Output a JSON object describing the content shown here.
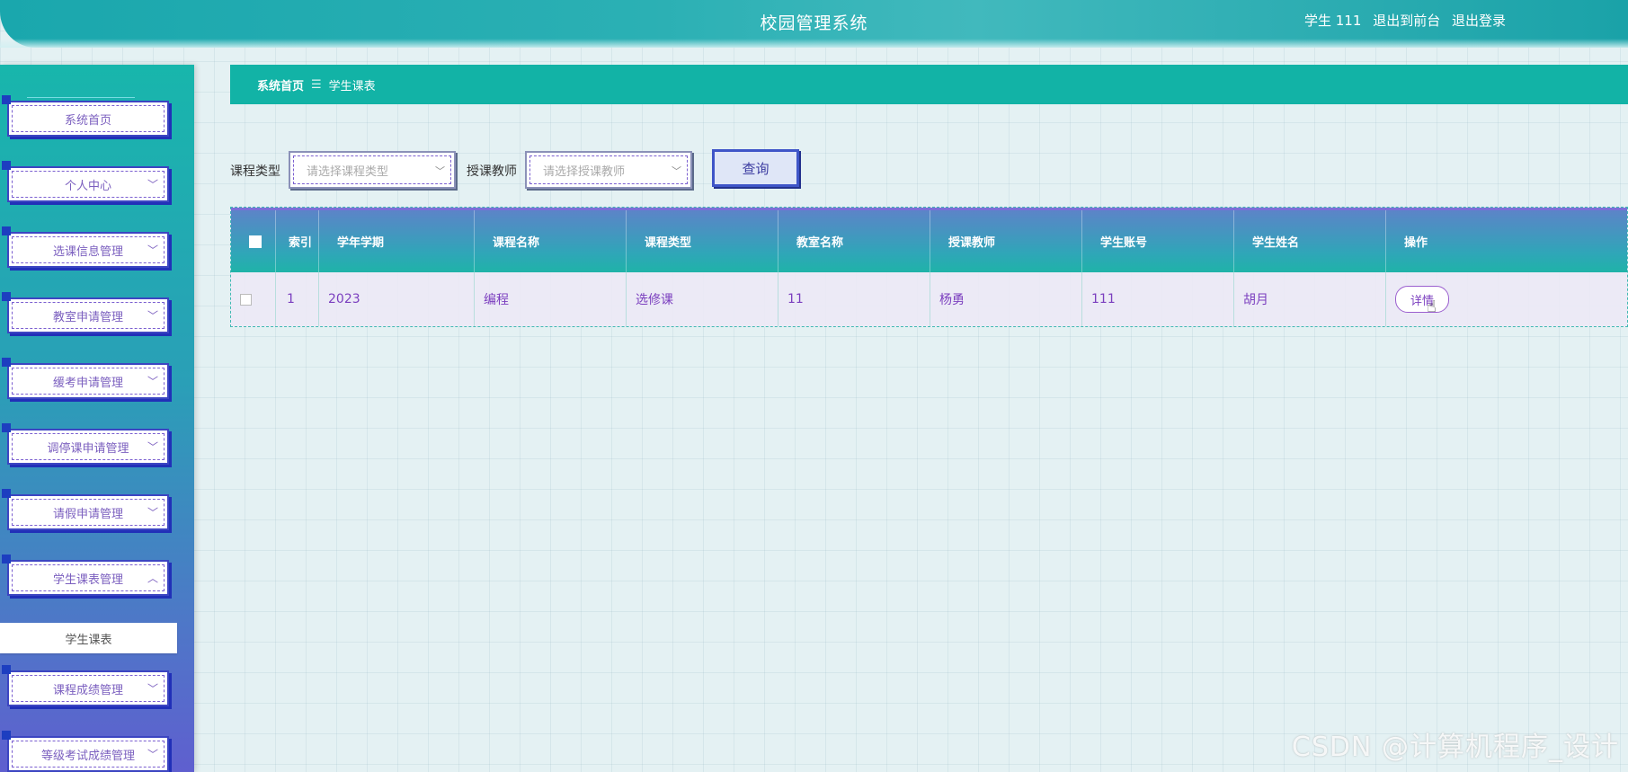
{
  "header": {
    "title": "校园管理系统",
    "user": "学生 111",
    "front_link": "退出到前台",
    "logout_link": "退出登录"
  },
  "sidebar": {
    "items": [
      {
        "label": "系统首页",
        "has_chevron": false
      },
      {
        "label": "个人中心",
        "has_chevron": true
      },
      {
        "label": "选课信息管理",
        "has_chevron": true
      },
      {
        "label": "教室申请管理",
        "has_chevron": true
      },
      {
        "label": "缓考申请管理",
        "has_chevron": true
      },
      {
        "label": "调停课申请管理",
        "has_chevron": true
      },
      {
        "label": "请假申请管理",
        "has_chevron": true
      },
      {
        "label": "学生课表管理",
        "has_chevron": true,
        "expanded": true
      },
      {
        "label": "课程成绩管理",
        "has_chevron": true
      },
      {
        "label": "等级考试成绩管理",
        "has_chevron": true
      }
    ],
    "sub_item": "学生课表",
    "chevron_down": "﹀",
    "chevron_up": "︿"
  },
  "breadcrumb": {
    "home": "系统首页",
    "separator": "☰",
    "current": "学生课表"
  },
  "filters": {
    "course_type_label": "课程类型",
    "course_type_placeholder": "请选择课程类型",
    "teacher_label": "授课教师",
    "teacher_placeholder": "请选择授课教师",
    "query_button": "查询"
  },
  "table": {
    "columns": [
      "",
      "索引",
      "学年学期",
      "课程名称",
      "课程类型",
      "教室名称",
      "授课教师",
      "学生账号",
      "学生姓名",
      "操作"
    ],
    "rows": [
      {
        "index": "1",
        "term": "2023",
        "course": "编程",
        "type": "选修课",
        "classroom": "11",
        "teacher": "杨勇",
        "account": "111",
        "name": "胡月",
        "action": "详情"
      }
    ]
  },
  "watermark": "CSDN @计算机程序_设计",
  "colors": {
    "accent": "#12b3a6",
    "menu_border": "#3c45c2",
    "text_purple": "#7b3fbf"
  }
}
